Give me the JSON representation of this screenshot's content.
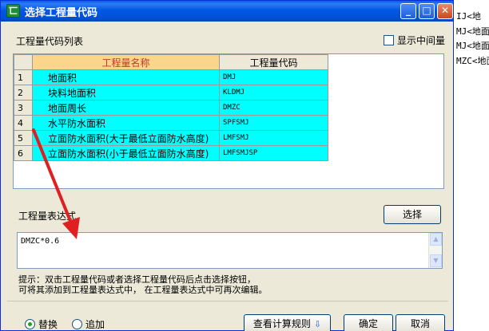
{
  "background_window": {
    "lines": [
      "IJ<地",
      "MJ<地面",
      "MJ<地面",
      "MZC<地面"
    ]
  },
  "dialog": {
    "title": "选择工程量代码",
    "title_icon_glyph": "匸",
    "buttons": {
      "minimize": "_",
      "maximize": "□",
      "close": "✕"
    }
  },
  "list_section": {
    "label": "工程量代码列表",
    "show_intermediate_label": "显示中间量",
    "show_intermediate_checked": false
  },
  "table": {
    "headers": {
      "name": "工程量名称",
      "code": "工程量代码"
    },
    "rows": [
      {
        "num": "1",
        "name": "地面积",
        "code": "DMJ"
      },
      {
        "num": "2",
        "name": "块料地面积",
        "code": "KLDMJ"
      },
      {
        "num": "3",
        "name": "地面周长",
        "code": "DMZC"
      },
      {
        "num": "4",
        "name": "水平防水面积",
        "code": "SPFSMJ"
      },
      {
        "num": "5",
        "name": "立面防水面积(大于最低立面防水高度)",
        "code": "LMFSMJ"
      },
      {
        "num": "6",
        "name": "立面防水面积(小于最低立面防水高度)",
        "code": "LMFSMJSP"
      }
    ]
  },
  "expression": {
    "label": "工程量表达式",
    "select_button": "选择",
    "value": "DMZC*0.6"
  },
  "hint": {
    "line1": "提示：双击工程量代码或者选择工程量代码后点击选择按钮，",
    "line2": "可将其添加到工程量表达式中， 在工程量表达式中可再次编辑。"
  },
  "mode": {
    "replace_label": "替换",
    "append_label": "追加",
    "selected": "替换"
  },
  "footer": {
    "rules_button": "查看计算规则",
    "ok_button": "确定",
    "cancel_button": "取消"
  },
  "colors": {
    "title_bar": "#0058e2",
    "selected_cell": "#00ffff",
    "name_header": "#fbd68a",
    "annotation_arrow": "#e02020"
  }
}
